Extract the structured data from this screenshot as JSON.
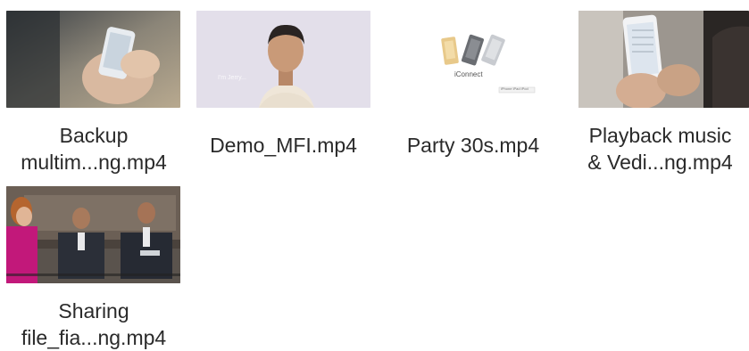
{
  "files": [
    {
      "name_lines": [
        "Backup",
        "multim...ng.mp4"
      ],
      "thumbnail": "hands-holding-phone"
    },
    {
      "name_lines": [
        "Demo_MFI.mp4"
      ],
      "thumbnail": "man-portrait",
      "thumb_caption": "I'm Jerry..."
    },
    {
      "name_lines": [
        "Party 30s.mp4"
      ],
      "thumbnail": "usb-drives-product",
      "thumb_caption": "iConnect",
      "thumb_caption2": "iPhone iPad iPod"
    },
    {
      "name_lines": [
        "Playback music",
        "& Vedi...ng.mp4"
      ],
      "thumbnail": "phone-in-hand-closeup"
    },
    {
      "name_lines": [
        "Sharing",
        "file_fia...ng.mp4"
      ],
      "thumbnail": "people-in-lounge"
    }
  ]
}
